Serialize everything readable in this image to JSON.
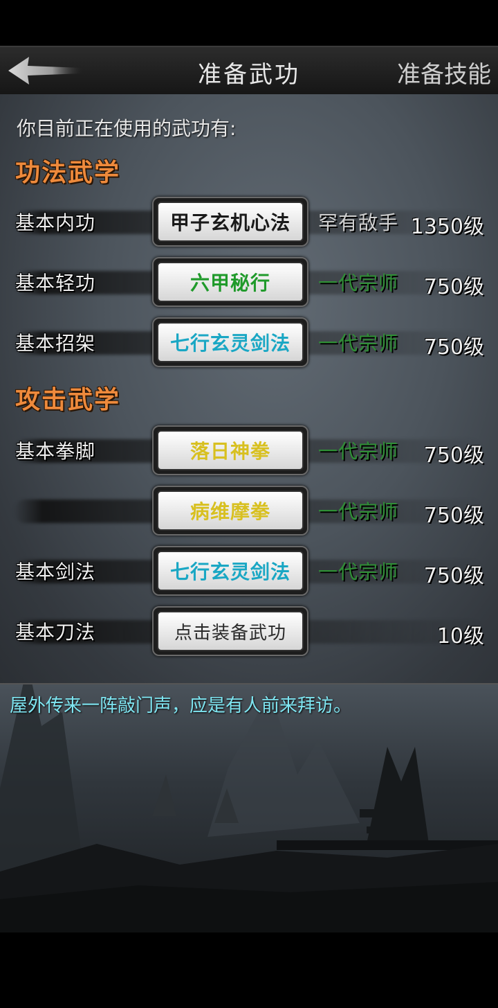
{
  "header": {
    "back_icon": "back-arrow-icon",
    "title": "准备武功",
    "right_action": "准备技能"
  },
  "intro_text": "你目前正在使用的武功有:",
  "sections": [
    {
      "title": "功法武学",
      "rows": [
        {
          "category": "基本内功",
          "skill": "甲子玄机心法",
          "skill_color": "#1a1a1a",
          "rank": "罕有敌手",
          "rank_color": "#cfcfcf",
          "level": "1350级"
        },
        {
          "category": "基本轻功",
          "skill": "六甲秘行",
          "skill_color": "#1f9a2a",
          "rank": "一代宗师",
          "rank_color": "#2f8f36",
          "level": "750级"
        },
        {
          "category": "基本招架",
          "skill": "七行玄灵剑法",
          "skill_color": "#1aa7c4",
          "rank": "一代宗师",
          "rank_color": "#2f8f36",
          "level": "750级"
        }
      ]
    },
    {
      "title": "攻击武学",
      "rows": [
        {
          "category": "基本拳脚",
          "skill": "落日神拳",
          "skill_color": "#d8c020",
          "rank": "一代宗师",
          "rank_color": "#2f8f36",
          "level": "750级"
        },
        {
          "category": "",
          "skill": "病维摩拳",
          "skill_color": "#d8c020",
          "rank": "一代宗师",
          "rank_color": "#2f8f36",
          "level": "750级"
        },
        {
          "category": "基本剑法",
          "skill": "七行玄灵剑法",
          "skill_color": "#1aa7c4",
          "rank": "一代宗师",
          "rank_color": "#2f8f36",
          "level": "750级"
        },
        {
          "category": "基本刀法",
          "skill": "点击装备武功",
          "skill_color": "#2a2a2a",
          "rank": "",
          "rank_color": "#2f8f36",
          "level": "10级"
        }
      ]
    }
  ],
  "message": "屋外传来一阵敲门声，应是有人前来拜访。",
  "colors": {
    "section_title": "#ee8a3c",
    "message": "#7fe6f2"
  }
}
